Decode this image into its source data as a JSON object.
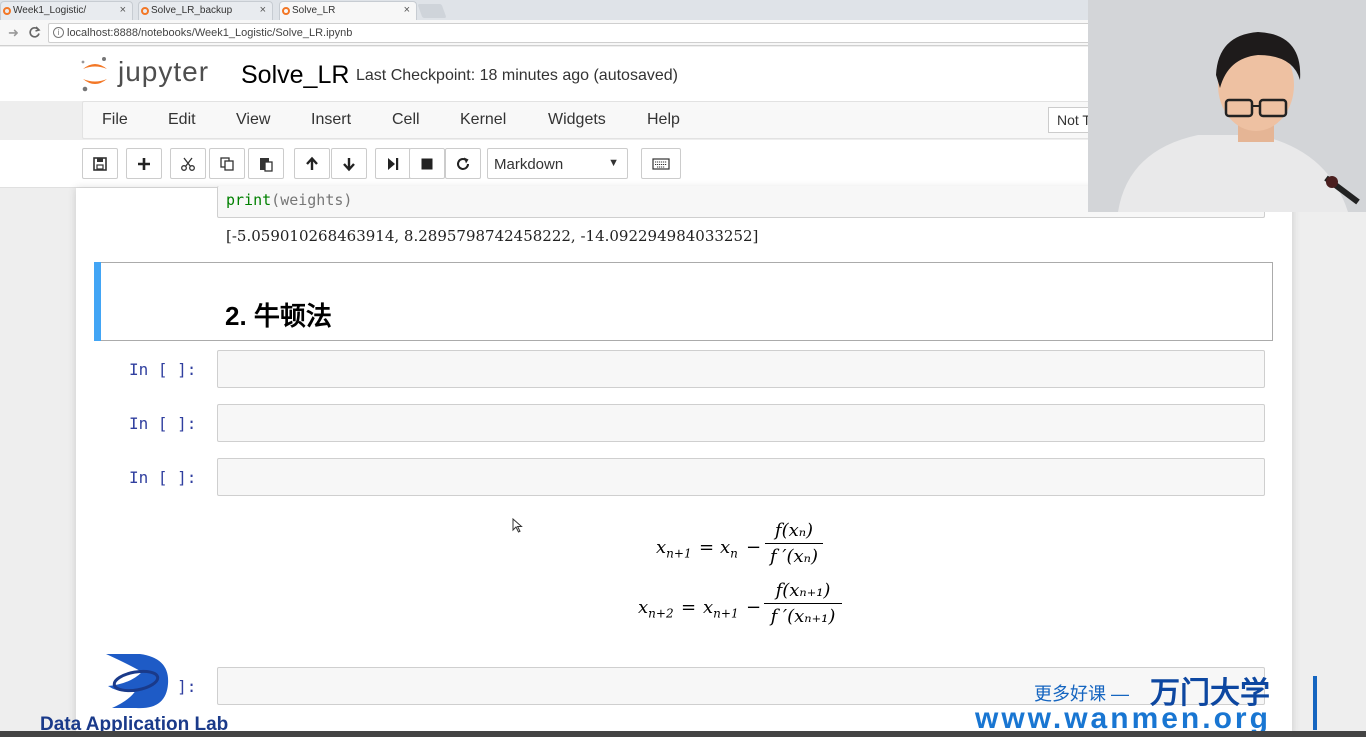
{
  "browser": {
    "tabs": [
      {
        "label": "Week1_Logistic/"
      },
      {
        "label": "Solve_LR_backup"
      },
      {
        "label": "Solve_LR"
      }
    ],
    "tab_close": "×",
    "url": "localhost:8888/notebooks/Week1_Logistic/Solve_LR.ipynb"
  },
  "header": {
    "logo_text": "jupyter",
    "notebook_name": "Solve_LR",
    "checkpoint": "Last Checkpoint: 18 minutes ago (autosaved)"
  },
  "menu": {
    "items": [
      "File",
      "Edit",
      "View",
      "Insert",
      "Cell",
      "Kernel",
      "Widgets",
      "Help"
    ],
    "trusted_label": "Not Trusted"
  },
  "toolbar": {
    "cell_type": "Markdown",
    "buttons": [
      "save-icon",
      "plus-icon",
      "cut-icon",
      "copy-icon",
      "paste-icon",
      "arrow-up-icon",
      "arrow-down-icon",
      "run-icon",
      "stop-icon",
      "restart-icon",
      "keyboard-icon"
    ]
  },
  "cells": {
    "code_fn": "print",
    "code_open": "(",
    "code_arg": "weights",
    "code_close": ")",
    "output": "[-5.059010268463914, 8.2895798742458222, -14.092294984033252]",
    "markdown_title": "2. 牛顿法",
    "prompt": "In [ ]:",
    "prompt_last": "In [ ]:"
  },
  "math": {
    "eq1_lhs": "x",
    "eq1_lhs_sub": "n+1",
    "eq1_rhs_x": "x",
    "eq1_rhs_sub": "n",
    "eq1_num": "f(xₙ)",
    "eq1_den": "f ′(xₙ)",
    "eq2_lhs": "x",
    "eq2_lhs_sub": "n+2",
    "eq2_rhs_x": "x",
    "eq2_rhs_sub": "n+1",
    "eq2_num": "f(xₙ₊₁)",
    "eq2_den": "f ′(xₙ₊₁)",
    "equals": "=",
    "minus": "−"
  },
  "watermarks": {
    "lab": "Data Application Lab",
    "slogan": "更多好课 —",
    "brand": "万门大学",
    "url": "www.wanmen.org"
  },
  "colors": {
    "jupyter_orange": "#f37726",
    "md_selected": "#42a5f5",
    "prompt": "#303f9f",
    "wanmen_blue": "#1976d2"
  }
}
